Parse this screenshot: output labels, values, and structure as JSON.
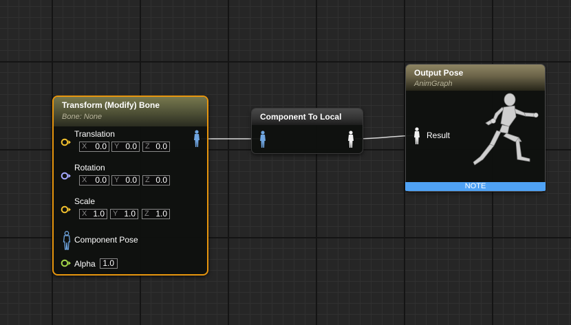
{
  "nodes": {
    "transform": {
      "title": "Transform (Modify) Bone",
      "subtitle": "Bone: None",
      "translation": {
        "label": "Translation",
        "x_axis": "X",
        "x": "0.0",
        "y_axis": "Y",
        "y": "0.0",
        "z_axis": "Z",
        "z": "0.0"
      },
      "rotation": {
        "label": "Rotation",
        "x_axis": "X",
        "x": "0.0",
        "y_axis": "Y",
        "y": "0.0",
        "z_axis": "Z",
        "z": "0.0"
      },
      "scale": {
        "label": "Scale",
        "x_axis": "X",
        "x": "1.0",
        "y_axis": "Y",
        "y": "1.0",
        "z_axis": "Z",
        "z": "1.0"
      },
      "component_pose_label": "Component Pose",
      "alpha": {
        "label": "Alpha",
        "value": "1.0"
      }
    },
    "component_to_local": {
      "title": "Component To Local"
    },
    "output_pose": {
      "title": "Output Pose",
      "subtitle": "AnimGraph",
      "result_label": "Result",
      "note_label": "NOTE"
    }
  },
  "colors": {
    "selection_border": "#e8960e",
    "vector_pin": "#f2c12e",
    "rotator_pin": "#a5a8ff",
    "float_pin": "#a4d64a",
    "pose_pin": "#6fa5e0",
    "note_bar": "#4fa2f5"
  },
  "icons": {
    "vector_pin": "circle-arrow-pin",
    "pose_pin": "figure-pin",
    "result_pose": "running-mannequin"
  }
}
